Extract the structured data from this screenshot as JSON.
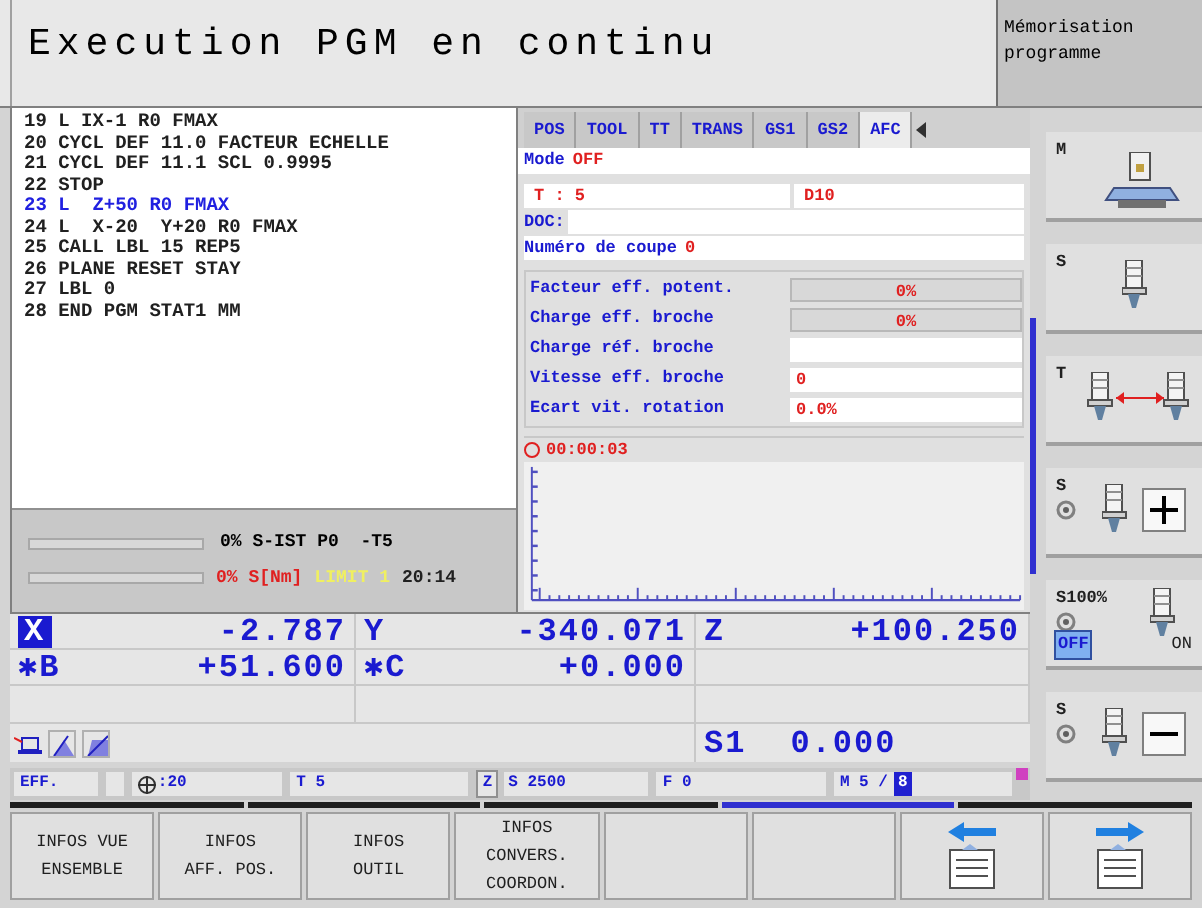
{
  "header": {
    "title": "Execution PGM en continu",
    "mode_label": "Mémorisation programme"
  },
  "program": [
    {
      "text": "19 L IX-1 R0 FMAX",
      "selected": false
    },
    {
      "text": "20 CYCL DEF 11.0 FACTEUR ECHELLE",
      "selected": false
    },
    {
      "text": "21 CYCL DEF 11.1 SCL 0.9995",
      "selected": false
    },
    {
      "text": "22 STOP",
      "selected": false
    },
    {
      "text": "23 L  Z+50 R0 FMAX",
      "selected": true
    },
    {
      "text": "24 L  X-20  Y+20 R0 FMAX",
      "selected": false
    },
    {
      "text": "25 CALL LBL 15 REP5",
      "selected": false
    },
    {
      "text": "26 PLANE RESET STAY",
      "selected": false
    },
    {
      "text": "27 LBL 0",
      "selected": false
    },
    {
      "text": "28 END PGM STAT1 MM",
      "selected": false
    }
  ],
  "spindle_status": {
    "line_1": "0% S-IST P0  -T5",
    "line_2": [
      {
        "kind": "load",
        "text": "0% S[Nm]"
      },
      {
        "kind": "limit",
        "text": "LIMIT 1"
      },
      {
        "kind": "time",
        "text": "20:14"
      }
    ]
  },
  "tabs": [
    {
      "label": "POS",
      "selected": false
    },
    {
      "label": "TOOL",
      "selected": false
    },
    {
      "label": "TT",
      "selected": false
    },
    {
      "label": "TRANS",
      "selected": false
    },
    {
      "label": "GS1",
      "selected": false
    },
    {
      "label": "GS2",
      "selected": false
    },
    {
      "label": "AFC",
      "selected": true
    }
  ],
  "afc": {
    "mode_label": "Mode",
    "mode_value": "OFF",
    "tool": "T : 5",
    "tool_name": "D10",
    "doc_label": "DOC:",
    "cut_label": "Numéro de coupe",
    "cut_value": "0",
    "metrics": [
      {
        "label": "Facteur eff. potent.",
        "value": "0%",
        "kind": "gauge"
      },
      {
        "label": "Charge eff. broche",
        "value": "0%",
        "kind": "gauge"
      },
      {
        "label": "Charge réf. broche",
        "kind": "field"
      },
      {
        "label": "Vitesse eff. broche",
        "value": "0",
        "kind": "field"
      },
      {
        "label": "Ecart vit. rotation",
        "value": "0.0%",
        "kind": "field"
      }
    ],
    "timer": "00:00:03"
  },
  "axes": [
    {
      "axis": "X",
      "value": "-2.787",
      "selected": true
    },
    {
      "axis": "Y",
      "value": "-340.071",
      "selected": false
    },
    {
      "axis": "Z",
      "value": "+100.250",
      "selected": false
    },
    {
      "axis": "✱B",
      "value": "+51.600",
      "selected": false
    },
    {
      "axis": "✱C",
      "value": "+0.000",
      "selected": false
    }
  ],
  "spindle": {
    "label": "S1",
    "value": "0.000"
  },
  "status_bar": [
    {
      "kind": "plain",
      "text": "EFF."
    },
    {
      "kind": "empty"
    },
    {
      "kind": "dial",
      "text": ":20"
    },
    {
      "kind": "plain",
      "text": "T 5"
    },
    {
      "kind": "axis",
      "tag": "Z",
      "text": "S 2500"
    },
    {
      "kind": "plain",
      "text": "F 0"
    },
    {
      "kind": "counter",
      "text": "M 5 /",
      "count": "8"
    }
  ],
  "side_keys": [
    {
      "kind": "table",
      "label": "M"
    },
    {
      "kind": "spindle",
      "label": "S"
    },
    {
      "kind": "toolchange",
      "label": "T"
    },
    {
      "kind": "plus",
      "label": "S"
    },
    {
      "kind": "override",
      "label": "S100%",
      "off": "OFF",
      "on": "ON",
      "off_selected": true
    },
    {
      "kind": "minus",
      "label": "S"
    }
  ],
  "soft_keys": [
    {
      "kind": "text",
      "lines": [
        "INFOS VUE",
        "ENSEMBLE"
      ]
    },
    {
      "kind": "text",
      "lines": [
        "INFOS",
        "AFF. POS."
      ]
    },
    {
      "kind": "text",
      "lines": [
        "INFOS",
        "OUTIL"
      ]
    },
    {
      "kind": "text",
      "lines": [
        "INFOS",
        "CONVERS.",
        "COORDON."
      ]
    },
    {
      "kind": "empty"
    },
    {
      "kind": "empty"
    },
    {
      "kind": "page_back"
    },
    {
      "kind": "page_forward"
    }
  ]
}
